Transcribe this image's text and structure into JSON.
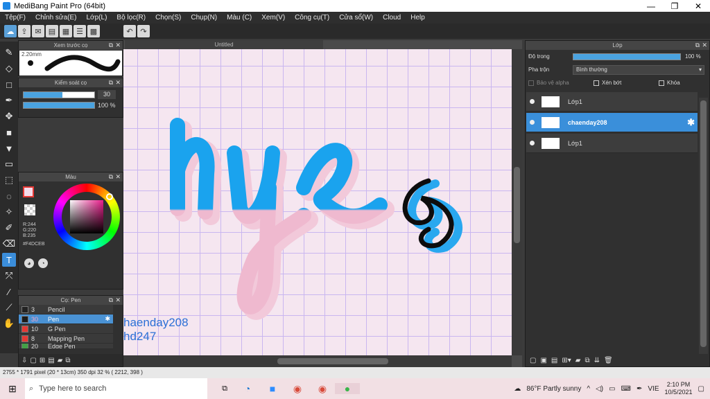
{
  "window": {
    "title": "MediBang Paint Pro (64bit)",
    "minimize": "—",
    "restore": "❐",
    "close": "✕"
  },
  "menu": [
    "Tệp(F)",
    "Chỉnh sửa(E)",
    "Lớp(L)",
    "Bộ lọc(R)",
    "Chọn(S)",
    "Chụp(N)",
    "Màu (C)",
    "Xem(V)",
    "Công cụ(T)",
    "Cửa sổ(W)",
    "Cloud",
    "Help"
  ],
  "toolbar": {
    "undo": "↶",
    "redo": "↷"
  },
  "document": {
    "tab_title": "Untitled"
  },
  "brush_preview": {
    "title": "Xem trước cọ",
    "size_label": "2.20mm"
  },
  "brush_control": {
    "title": "Kiểm soát cọ",
    "size_value": "30",
    "opacity_value": "100 %",
    "size_fraction": 0.55,
    "opacity_fraction": 1.0
  },
  "color": {
    "title": "Màu",
    "r": "R:244",
    "g": "G:220",
    "b": "B:235",
    "hex": "#F4DCEB",
    "current_color": "#F4DCEB"
  },
  "pen_list": {
    "title": "Cọ: Pen",
    "items": [
      {
        "num": "3",
        "name": "Pencil",
        "swatch": "#222222"
      },
      {
        "num": "30",
        "name": "Pen",
        "swatch": "#1b1b1b"
      },
      {
        "num": "10",
        "name": "G Pen",
        "swatch": "#e53935"
      },
      {
        "num": "8",
        "name": "Mapping Pen",
        "swatch": "#e53935"
      },
      {
        "num": "20",
        "name": "Edge Pen",
        "swatch": "#43a047"
      }
    ]
  },
  "canvas": {
    "lettering": "hye",
    "watermark_line1": "haenday208",
    "watermark_line2": "hd247"
  },
  "layers": {
    "title": "Lớp",
    "opacity_label": "Độ trong",
    "opacity_value": "100 %",
    "opacity_fraction": 1.0,
    "blend_label": "Pha trộn",
    "blend_value": "Bình thường",
    "protect_alpha": "Bảo vệ alpha",
    "clipping": "Xén bớt",
    "lock": "Khóa",
    "items": [
      {
        "name": "Lớp1",
        "selected": false
      },
      {
        "name": "chaenday208",
        "selected": true
      },
      {
        "name": "Lớp1",
        "selected": false
      }
    ]
  },
  "status": {
    "text": "2755 * 1791 pixel  (20 * 13cm)  350 dpi  32 %  ( 2212, 398 )"
  },
  "taskbar": {
    "search_placeholder": "Type here to search",
    "weather": "86°F  Partly sunny",
    "lang": "VIE",
    "time": "2:10 PM",
    "date": "10/5/2021"
  }
}
